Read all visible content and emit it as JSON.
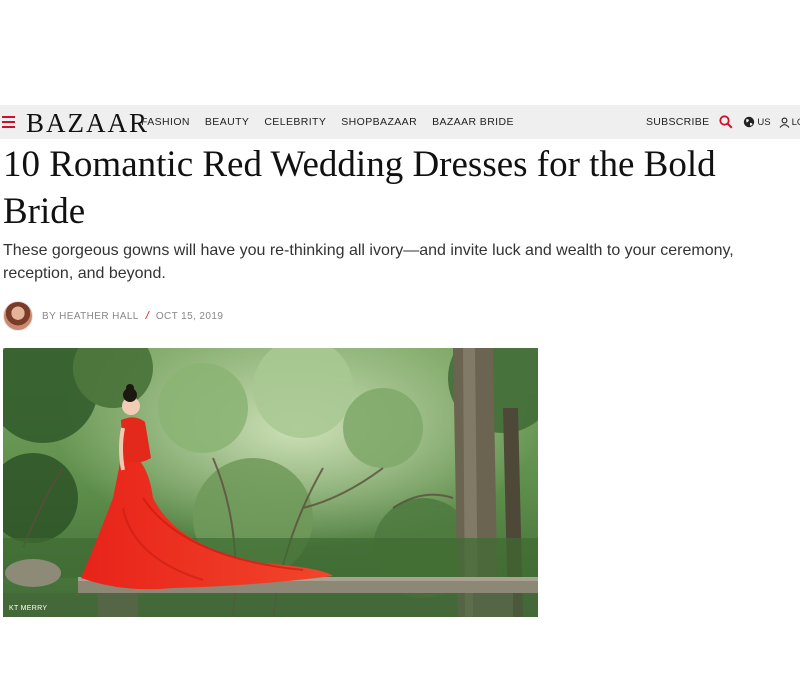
{
  "nav": {
    "logo": "BAZAAR",
    "links": [
      "FASHION",
      "BEAUTY",
      "CELEBRITY",
      "SHOPBAZAAR",
      "BAZAAR BRIDE"
    ],
    "subscribe": "SUBSCRIBE",
    "region": "US",
    "login": "LOG",
    "icons": [
      "hamburger-menu-icon",
      "search-icon",
      "globe-icon",
      "user-icon"
    ],
    "accent_color": "#d0102b"
  },
  "article": {
    "headline": "10 Romantic Red Wedding Dresses for the Bold Bride",
    "dek": "These gorgeous gowns will have you re-thinking all ivory—and invite luck and wealth to your ceremony, reception, and beyond.",
    "author": "BY HEATHER HALL",
    "separator": "/",
    "date": "OCT 15, 2019",
    "image_credit": "KT MERRY"
  }
}
